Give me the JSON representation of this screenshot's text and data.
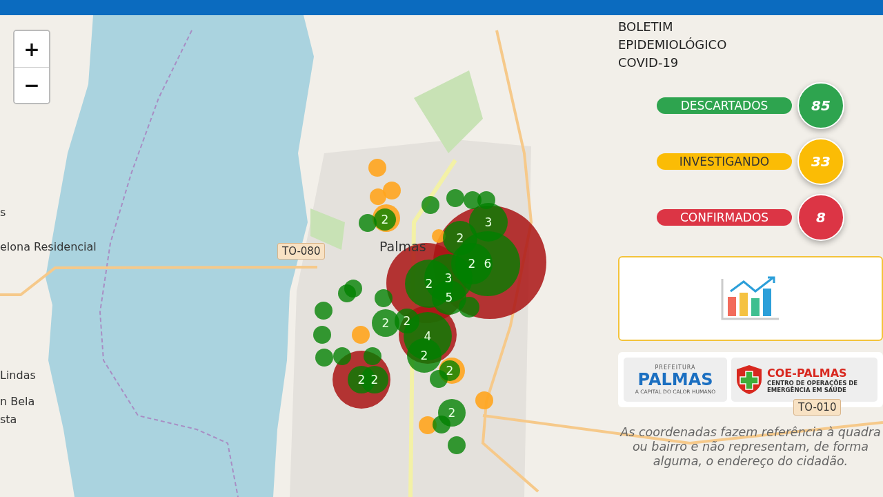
{
  "zoom_controls": [
    {
      "label": "+"
    },
    {
      "label": "−"
    }
  ],
  "map_labels": [
    {
      "kind": "place",
      "text": "s"
    },
    {
      "kind": "place",
      "text": "elona Residencial"
    },
    {
      "kind": "place",
      "text": "Lindas"
    },
    {
      "kind": "place",
      "text": "n Bela"
    },
    {
      "kind": "place",
      "text": "sta"
    },
    {
      "kind": "road",
      "text": "TO-080"
    },
    {
      "kind": "city",
      "text": "Palmas"
    },
    {
      "kind": "road",
      "text": "TO-010"
    }
  ],
  "markers": [
    {
      "kind": "confirmed"
    },
    {
      "kind": "confirmed"
    },
    {
      "kind": "confirmed"
    },
    {
      "kind": "confirmed"
    },
    {
      "kind": "investigating"
    },
    {
      "kind": "investigating"
    },
    {
      "kind": "investigating"
    },
    {
      "kind": "investigating"
    },
    {
      "kind": "investigating"
    },
    {
      "kind": "investigating"
    },
    {
      "kind": "investigating"
    },
    {
      "kind": "investigating"
    },
    {
      "kind": "investigating"
    },
    {
      "kind": "discarded"
    },
    {
      "kind": "discarded"
    },
    {
      "kind": "discarded"
    },
    {
      "kind": "discarded"
    },
    {
      "kind": "discarded"
    },
    {
      "kind": "discarded",
      "label": "2"
    },
    {
      "kind": "discarded",
      "label": "3"
    },
    {
      "kind": "discarded",
      "label": "2"
    },
    {
      "kind": "discarded",
      "label": "6"
    },
    {
      "kind": "discarded",
      "label": "2"
    },
    {
      "kind": "discarded",
      "label": "3"
    },
    {
      "kind": "discarded",
      "label": "2"
    },
    {
      "kind": "discarded",
      "label": "5"
    },
    {
      "kind": "discarded"
    },
    {
      "kind": "discarded"
    },
    {
      "kind": "discarded"
    },
    {
      "kind": "discarded"
    },
    {
      "kind": "discarded"
    },
    {
      "kind": "discarded"
    },
    {
      "kind": "discarded"
    },
    {
      "kind": "discarded"
    },
    {
      "kind": "discarded",
      "label": "2"
    },
    {
      "kind": "discarded",
      "label": "2"
    },
    {
      "kind": "discarded",
      "label": "4"
    },
    {
      "kind": "discarded",
      "label": "2"
    },
    {
      "kind": "discarded"
    },
    {
      "kind": "discarded",
      "label": "2"
    },
    {
      "kind": "discarded",
      "label": "2"
    },
    {
      "kind": "discarded"
    },
    {
      "kind": "discarded",
      "label": "2"
    },
    {
      "kind": "discarded",
      "label": "2"
    },
    {
      "kind": "discarded"
    },
    {
      "kind": "discarded"
    }
  ],
  "bulletin": {
    "title": "BOLETIM EPIDEMIOLÓGICO",
    "subtitle": "COVID-19"
  },
  "stats": [
    {
      "label": "DESCARTADOS",
      "count": "85",
      "color": "#2ea44f"
    },
    {
      "label": "INVESTIGANDO",
      "count": "33",
      "color": "#fbbc05"
    },
    {
      "label": "CONFIRMADOS",
      "count": "8",
      "color": "#dc3545"
    }
  ],
  "logos": {
    "palmas": {
      "top": "PREFEITURA",
      "name": "PALMAS",
      "tagline": "A CAPITAL DO CALOR HUMANO"
    },
    "coe": {
      "name": "COE-PALMAS",
      "line_1": "CENTRO DE OPERAÇÕES DE",
      "line_2": "EMERGÊNCIA EM SAÚDE"
    }
  },
  "disclaimer": "As coordenadas fazem referência à quadra ou bairro e não representam, de forma alguma, o endereço do cidadão."
}
